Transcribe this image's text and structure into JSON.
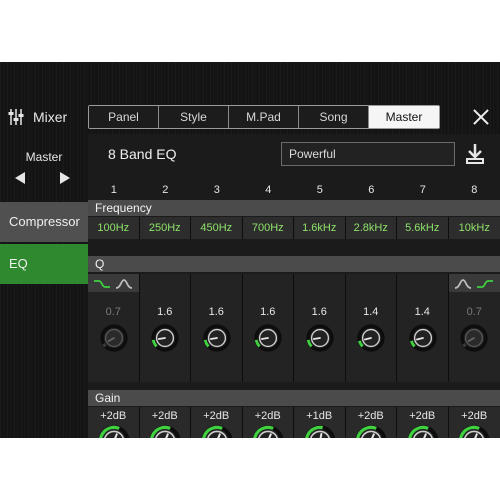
{
  "app": {
    "title": "Mixer"
  },
  "tabs": [
    "Panel",
    "Style",
    "M.Pad",
    "Song",
    "Master"
  ],
  "active_tab": "Master",
  "sidebar": {
    "scope": "Master",
    "items": [
      "Compressor",
      "EQ"
    ],
    "active": "EQ"
  },
  "eq": {
    "title": "8 Band EQ",
    "preset": "Powerful",
    "sections": {
      "frequency": "Frequency",
      "q": "Q",
      "gain": "Gain"
    },
    "bands": [
      {
        "num": "1",
        "freq": "100Hz",
        "q": "0.7",
        "q_active": false,
        "gain": "+2dB",
        "gain_db": 2,
        "q_value": 0.7
      },
      {
        "num": "2",
        "freq": "250Hz",
        "q": "1.6",
        "q_active": true,
        "gain": "+2dB",
        "gain_db": 2,
        "q_value": 1.6
      },
      {
        "num": "3",
        "freq": "450Hz",
        "q": "1.6",
        "q_active": true,
        "gain": "+2dB",
        "gain_db": 2,
        "q_value": 1.6
      },
      {
        "num": "4",
        "freq": "700Hz",
        "q": "1.6",
        "q_active": true,
        "gain": "+2dB",
        "gain_db": 2,
        "q_value": 1.6
      },
      {
        "num": "5",
        "freq": "1.6kHz",
        "q": "1.6",
        "q_active": true,
        "gain": "+1dB",
        "gain_db": 1,
        "q_value": 1.6
      },
      {
        "num": "6",
        "freq": "2.8kHz",
        "q": "1.4",
        "q_active": true,
        "gain": "+2dB",
        "gain_db": 2,
        "q_value": 1.4
      },
      {
        "num": "7",
        "freq": "5.6kHz",
        "q": "1.4",
        "q_active": true,
        "gain": "+2dB",
        "gain_db": 2,
        "q_value": 1.4
      },
      {
        "num": "8",
        "freq": "10kHz",
        "q": "0.7",
        "q_active": false,
        "gain": "+2dB",
        "gain_db": 2,
        "q_value": 0.7
      }
    ]
  },
  "colors": {
    "accent": "#3fd13f",
    "selected_side": "#2f8a2f",
    "freq_text": "#8fe36a"
  }
}
